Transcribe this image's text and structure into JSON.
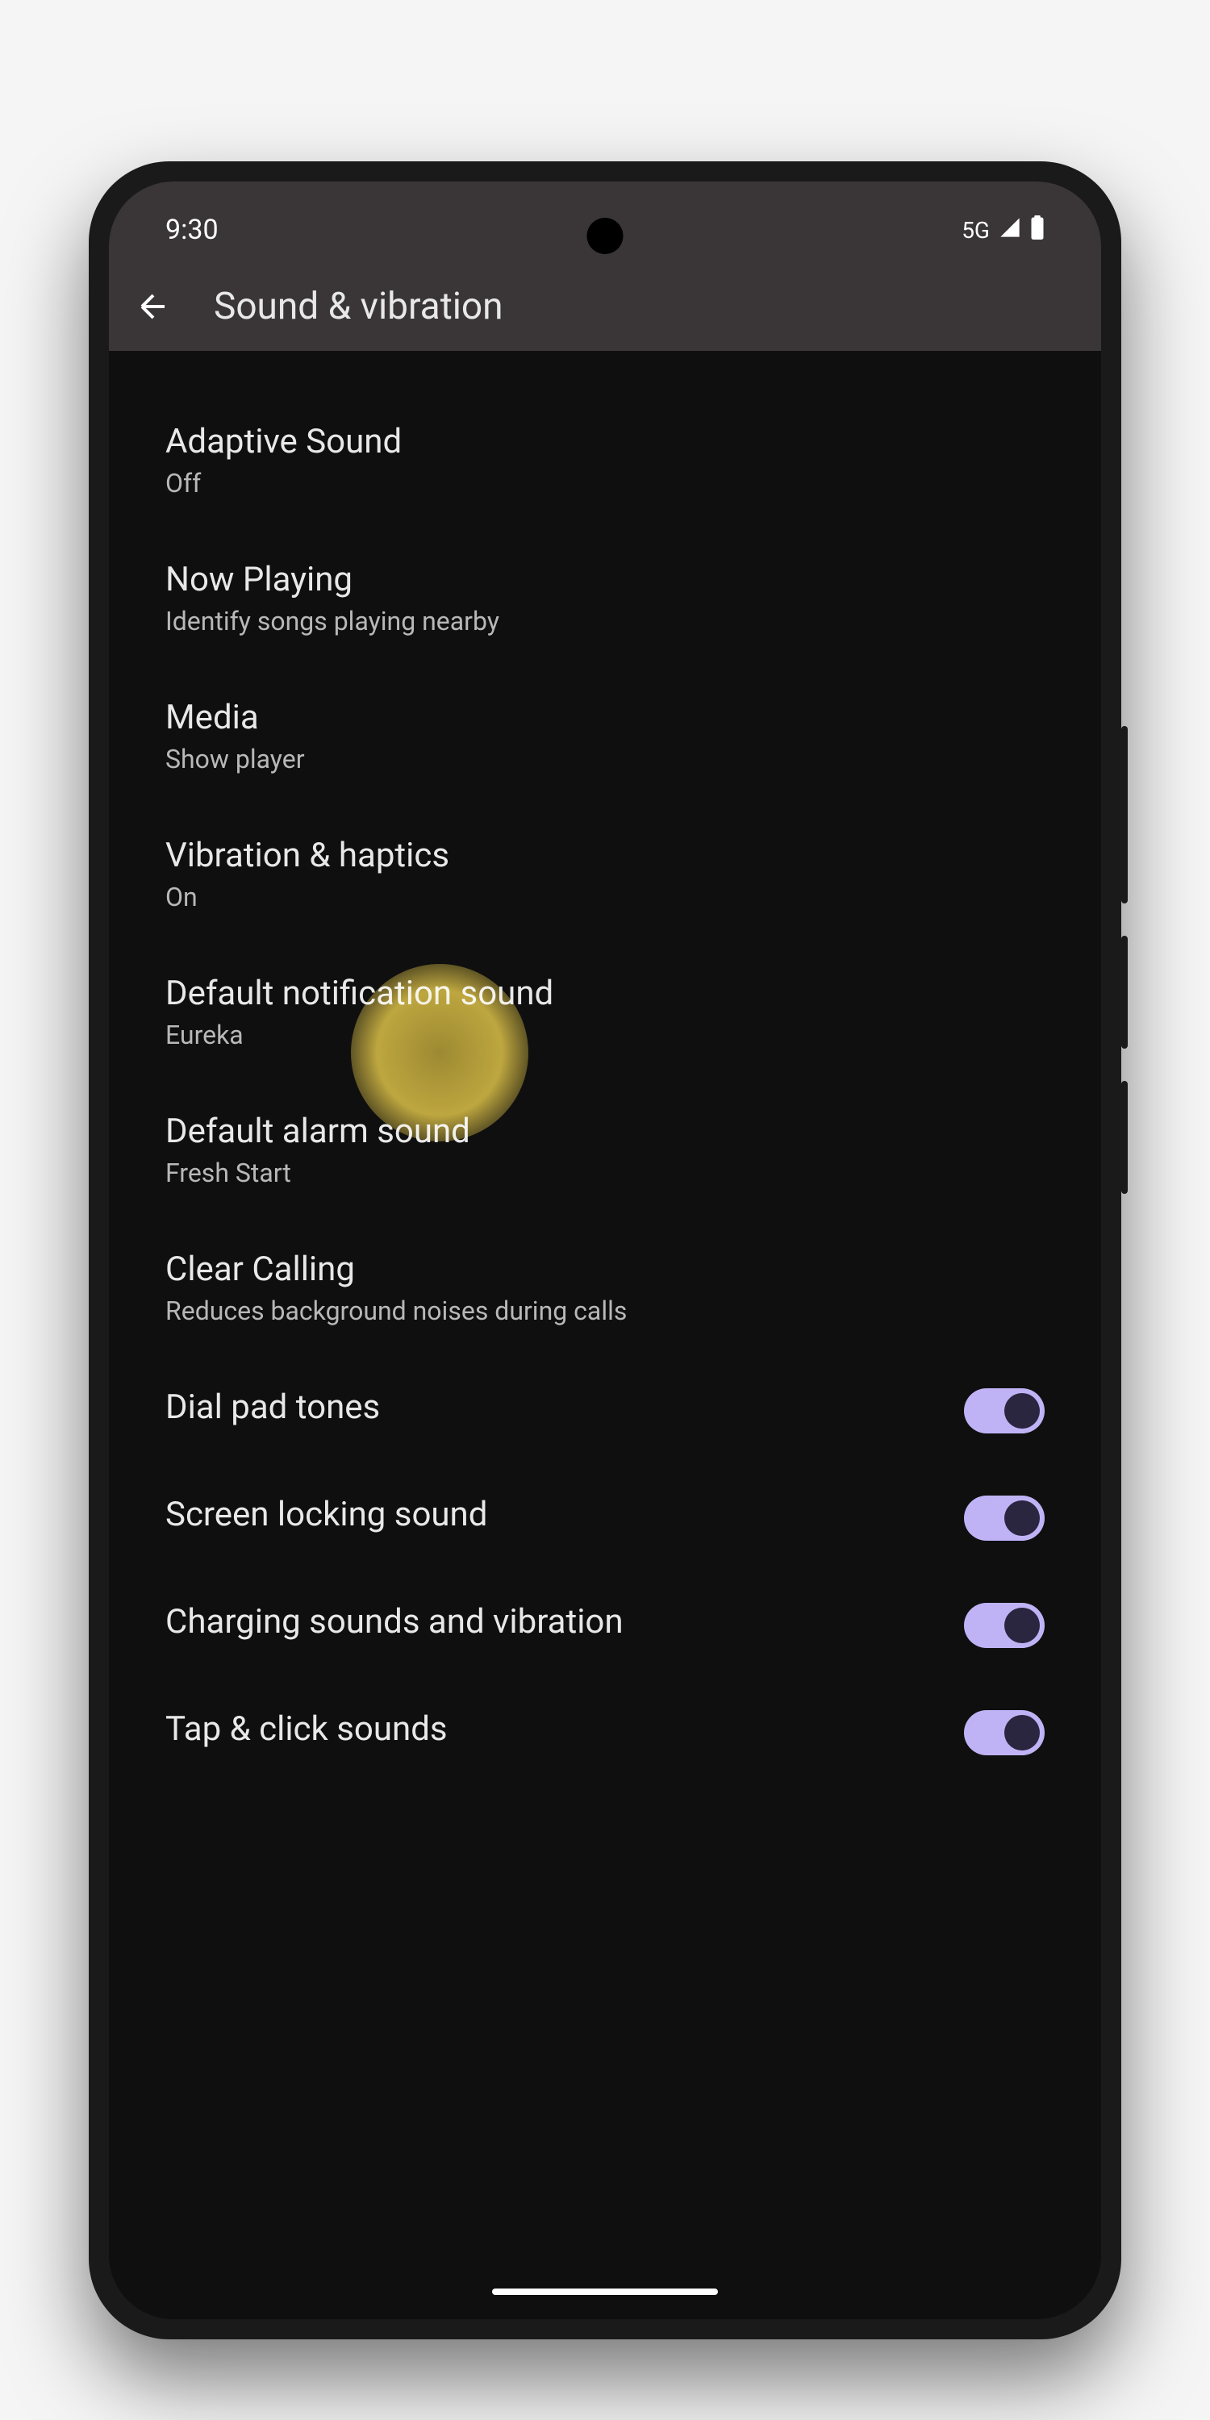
{
  "statusBar": {
    "time": "9:30",
    "network": "5G"
  },
  "header": {
    "title": "Sound & vibration"
  },
  "settings": [
    {
      "title": "Adaptive Sound",
      "subtitle": "Off",
      "hasToggle": false
    },
    {
      "title": "Now Playing",
      "subtitle": "Identify songs playing nearby",
      "hasToggle": false
    },
    {
      "title": "Media",
      "subtitle": "Show player",
      "hasToggle": false
    },
    {
      "title": "Vibration & haptics",
      "subtitle": "On",
      "hasToggle": false,
      "highlighted": true
    },
    {
      "title": "Default notification sound",
      "subtitle": "Eureka",
      "hasToggle": false
    },
    {
      "title": "Default alarm sound",
      "subtitle": "Fresh Start",
      "hasToggle": false
    },
    {
      "title": "Clear Calling",
      "subtitle": "Reduces background noises during calls",
      "hasToggle": false
    },
    {
      "title": "Dial pad tones",
      "subtitle": "",
      "hasToggle": true,
      "toggleOn": true
    },
    {
      "title": "Screen locking sound",
      "subtitle": "",
      "hasToggle": true,
      "toggleOn": true
    },
    {
      "title": "Charging sounds and vibration",
      "subtitle": "",
      "hasToggle": true,
      "toggleOn": true
    },
    {
      "title": "Tap & click sounds",
      "subtitle": "",
      "hasToggle": true,
      "toggleOn": true
    }
  ]
}
